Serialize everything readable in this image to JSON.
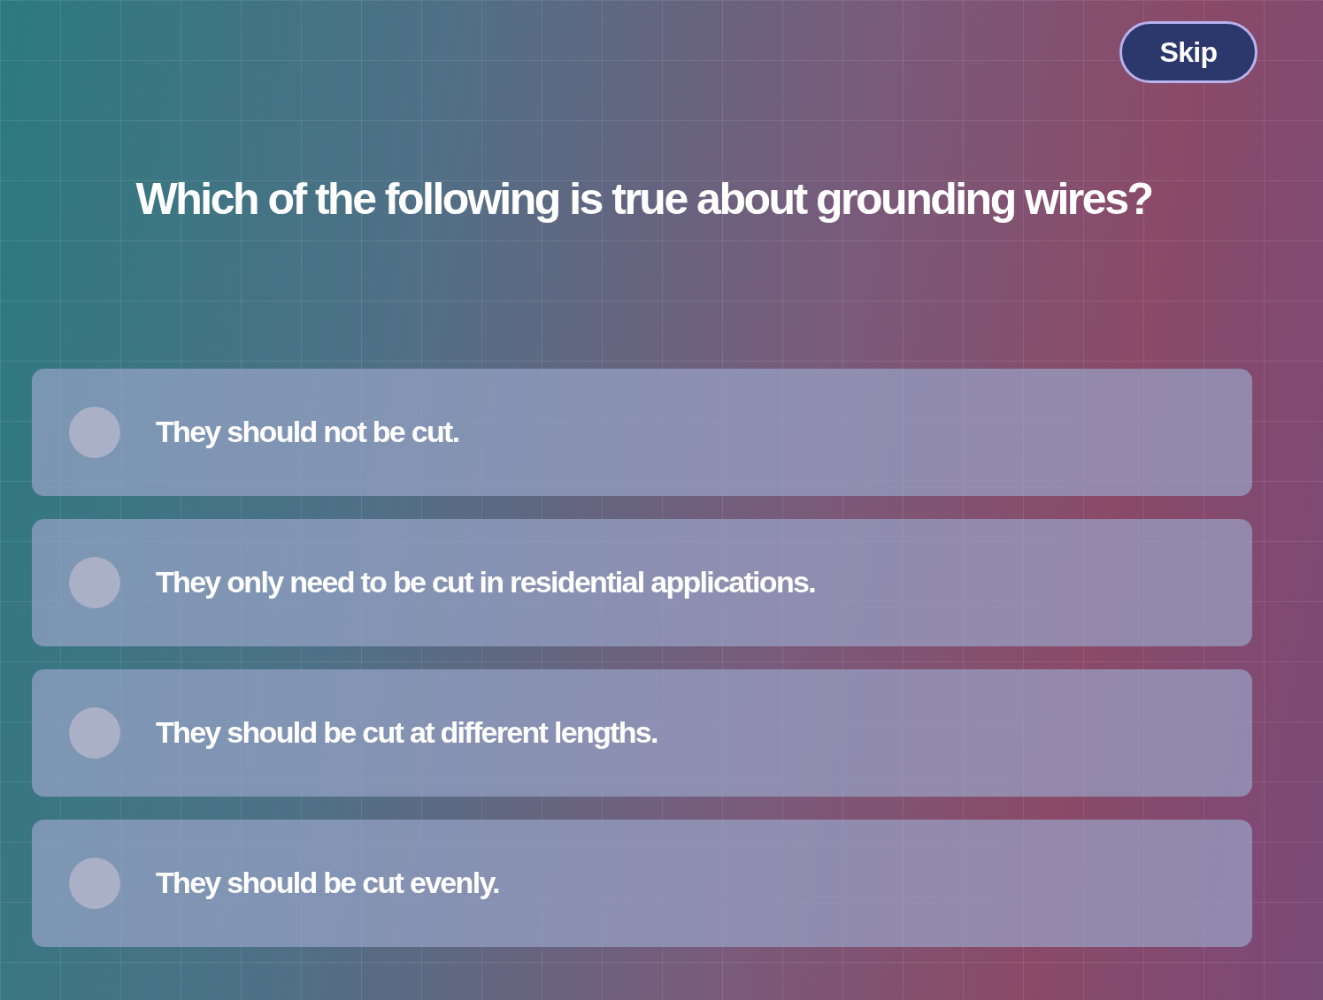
{
  "skip_button": {
    "label": "Skip"
  },
  "question": "Which of the following is true about grounding wires?",
  "options": [
    {
      "label": "They should not be cut.",
      "selected": false
    },
    {
      "label": "They only need to be cut in residential applications.",
      "selected": false
    },
    {
      "label": "They should be cut at different lengths.",
      "selected": false
    },
    {
      "label": "They should be cut evenly.",
      "selected": false
    }
  ]
}
